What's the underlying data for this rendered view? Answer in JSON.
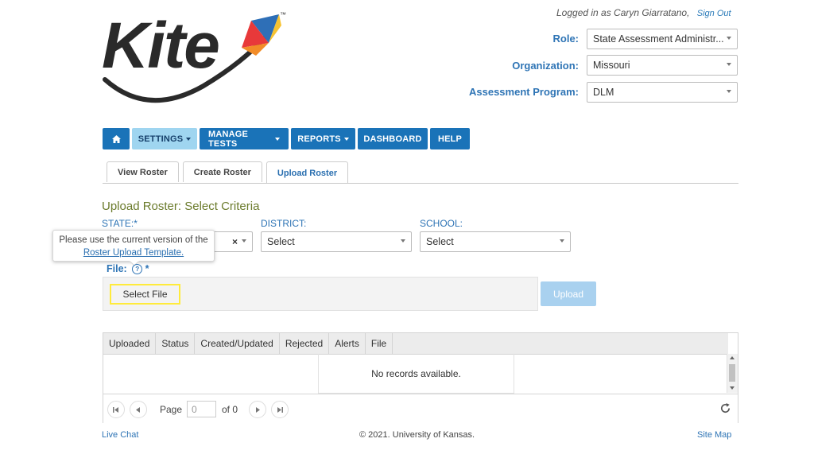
{
  "logo": {
    "text": "Kite",
    "tm": "™"
  },
  "header": {
    "logged_in_text": "Logged in as Caryn Giarratano,",
    "sign_out": "Sign Out",
    "role_label": "Role:",
    "role_value": "State Assessment Administr...",
    "org_label": "Organization:",
    "org_value": "Missouri",
    "program_label": "Assessment Program:",
    "program_value": "DLM"
  },
  "nav": {
    "home_icon": "home-icon",
    "settings": "SETTINGS",
    "manage_tests": "MANAGE TESTS",
    "reports": "REPORTS",
    "dashboard": "DASHBOARD",
    "help": "HELP"
  },
  "tabs": [
    "View Roster",
    "Create Roster",
    "Upload Roster"
  ],
  "criteria": {
    "title": "Upload Roster: Select Criteria",
    "state_label": "STATE:*",
    "district_label": "DISTRICT:",
    "district_value": "Select",
    "school_label": "SCHOOL:",
    "school_value": "Select",
    "clear_glyph": "×"
  },
  "tooltip": {
    "line1": "Please use the current version of the",
    "link": "Roster Upload Template."
  },
  "file": {
    "label": "File:",
    "help_glyph": "?",
    "required": "*",
    "select_file": "Select File",
    "upload": "Upload"
  },
  "grid": {
    "columns": [
      "Uploaded",
      "Status",
      "Created/Updated",
      "Rejected",
      "Alerts",
      "File"
    ],
    "empty_text": "No records available.",
    "page_word": "Page",
    "page_value": "0",
    "of_text": "of 0"
  },
  "footer": {
    "live_chat": "Live Chat",
    "copyright": "© 2021. University of Kansas.",
    "site_map": "Site Map"
  }
}
